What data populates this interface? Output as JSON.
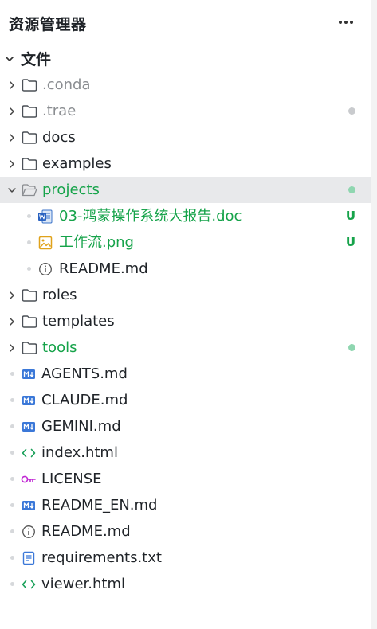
{
  "explorer": {
    "title": "资源管理器",
    "more_label": "···",
    "root": {
      "label": "文件",
      "expanded": true
    }
  },
  "colors": {
    "git_modified_dot": "#c9cbce",
    "git_untracked_dot": "#8fd6b0",
    "untracked_text": "#16a34a",
    "selected_row_bg": "#e8e9eb"
  },
  "items": [
    {
      "label": ".conda",
      "kind": "folder",
      "expanded": false,
      "tone": "dim"
    },
    {
      "label": ".trae",
      "kind": "folder",
      "expanded": false,
      "tone": "dim",
      "status": "dot-grey"
    },
    {
      "label": "docs",
      "kind": "folder",
      "expanded": false,
      "tone": "normal"
    },
    {
      "label": "examples",
      "kind": "folder",
      "expanded": false,
      "tone": "normal"
    },
    {
      "label": "projects",
      "kind": "folder-open",
      "expanded": true,
      "tone": "green",
      "selected": true,
      "status": "dot-green",
      "children": [
        {
          "label": "03-鸿蒙操作系统大报告.doc",
          "icon": "word-doc-icon",
          "tone": "green",
          "status": "U"
        },
        {
          "label": "工作流.png",
          "icon": "image-icon",
          "tone": "green",
          "status": "U"
        },
        {
          "label": "README.md",
          "icon": "info-icon",
          "tone": "normal"
        }
      ]
    },
    {
      "label": "roles",
      "kind": "folder",
      "expanded": false,
      "tone": "normal"
    },
    {
      "label": "templates",
      "kind": "folder",
      "expanded": false,
      "tone": "normal"
    },
    {
      "label": "tools",
      "kind": "folder",
      "expanded": false,
      "tone": "green",
      "status": "dot-green"
    },
    {
      "label": "AGENTS.md",
      "kind": "file",
      "icon": "markdown-icon",
      "tone": "normal"
    },
    {
      "label": "CLAUDE.md",
      "kind": "file",
      "icon": "markdown-icon",
      "tone": "normal"
    },
    {
      "label": "GEMINI.md",
      "kind": "file",
      "icon": "markdown-icon",
      "tone": "normal"
    },
    {
      "label": "index.html",
      "kind": "file",
      "icon": "code-icon",
      "tone": "normal"
    },
    {
      "label": "LICENSE",
      "kind": "file",
      "icon": "key-icon",
      "tone": "normal"
    },
    {
      "label": "README_EN.md",
      "kind": "file",
      "icon": "markdown-icon",
      "tone": "normal"
    },
    {
      "label": "README.md",
      "kind": "file",
      "icon": "info-icon",
      "tone": "normal"
    },
    {
      "label": "requirements.txt",
      "kind": "file",
      "icon": "text-file-icon",
      "tone": "normal"
    },
    {
      "label": "viewer.html",
      "kind": "file",
      "icon": "code-icon",
      "tone": "normal"
    }
  ]
}
